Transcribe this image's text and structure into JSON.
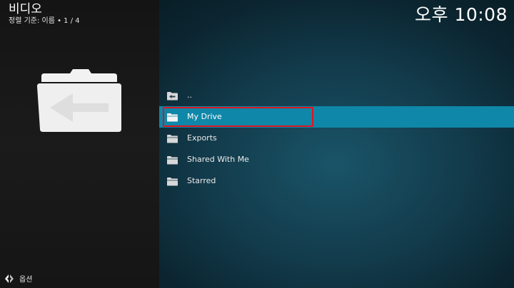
{
  "header": {
    "title": "비디오",
    "subtitle": "정렬 기준: 이름  •  1 / 4"
  },
  "clock": "오후 10:08",
  "list": {
    "items": [
      {
        "label": "..",
        "icon": "parent-folder-icon"
      },
      {
        "label": "My Drive",
        "icon": "folder-icon",
        "selected": true
      },
      {
        "label": "Exports",
        "icon": "folder-icon"
      },
      {
        "label": "Shared With Me",
        "icon": "folder-icon"
      },
      {
        "label": "Starred",
        "icon": "folder-icon"
      }
    ]
  },
  "footer": {
    "options_label": "옵션"
  },
  "colors": {
    "highlight": "#0f87a8",
    "focus_border": "#e0141e",
    "left_panel": "#1b1b1b"
  }
}
